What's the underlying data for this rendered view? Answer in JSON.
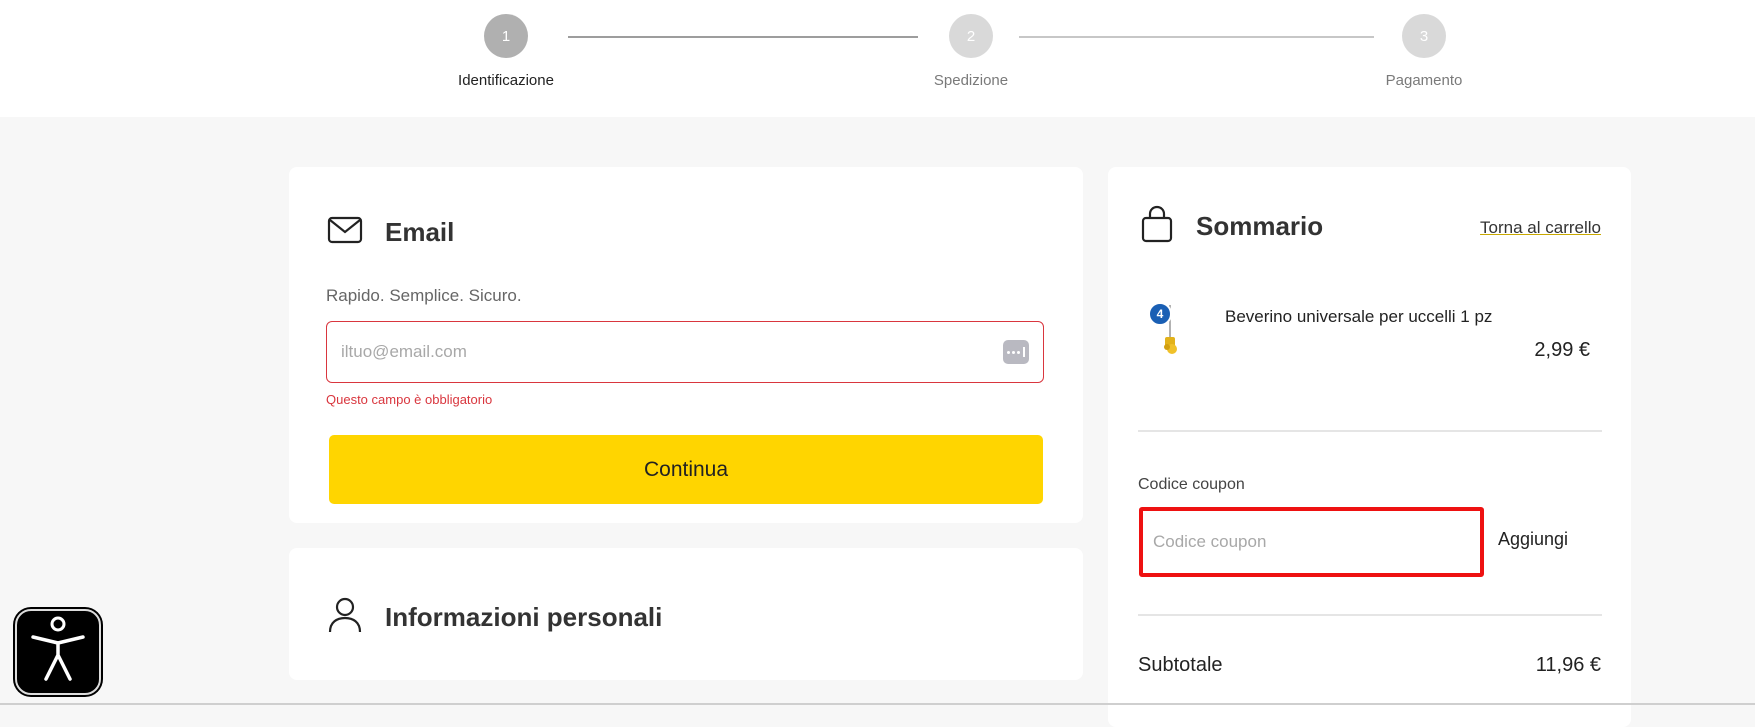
{
  "stepper": {
    "steps": [
      {
        "number": "1",
        "label": "Identificazione"
      },
      {
        "number": "2",
        "label": "Spedizione"
      },
      {
        "number": "3",
        "label": "Pagamento"
      }
    ]
  },
  "email_section": {
    "title": "Email",
    "subtitle": "Rapido. Semplice. Sicuro.",
    "input_placeholder": "iltuo@email.com",
    "input_value": "",
    "error": "Questo campo è obbligatorio",
    "continue_label": "Continua"
  },
  "info_section": {
    "title": "Informazioni personali"
  },
  "summary": {
    "title": "Sommario",
    "back_link": "Torna al carrello",
    "product": {
      "quantity": "4",
      "name": "Beverino universale per uccelli 1 pz",
      "price": "2,99 €"
    },
    "coupon": {
      "label": "Codice coupon",
      "placeholder": "Codice coupon",
      "value": "",
      "button_label": "Aggiungi"
    },
    "subtotal_label": "Subtotale",
    "subtotal_value": "11,96 €"
  },
  "colors": {
    "accent_yellow": "#ffd500",
    "error_red": "#d9363e",
    "highlight_red": "#ee1111",
    "badge_blue": "#1a5fb4"
  },
  "icons": {
    "email": "envelope-icon",
    "info": "user-icon",
    "summary": "shopping-bag-icon",
    "accessibility": "accessibility-icon",
    "password_manager": "password-manager-icon"
  }
}
